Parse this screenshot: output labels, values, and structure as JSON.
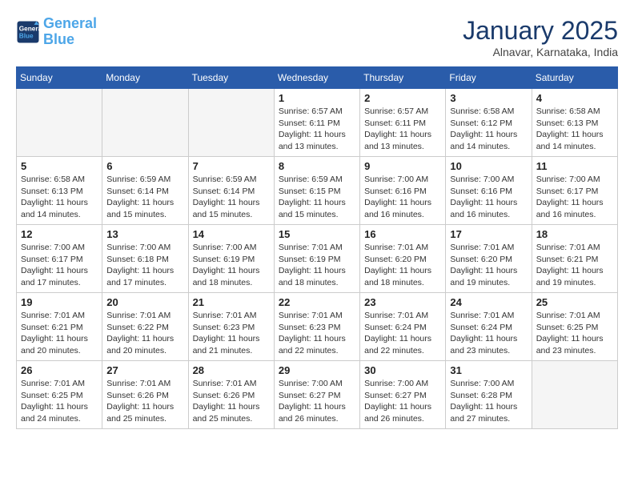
{
  "logo": {
    "line1": "General",
    "line2": "Blue"
  },
  "title": "January 2025",
  "location": "Alnavar, Karnataka, India",
  "days_of_week": [
    "Sunday",
    "Monday",
    "Tuesday",
    "Wednesday",
    "Thursday",
    "Friday",
    "Saturday"
  ],
  "weeks": [
    [
      {
        "day": "",
        "info": ""
      },
      {
        "day": "",
        "info": ""
      },
      {
        "day": "",
        "info": ""
      },
      {
        "day": "1",
        "info": "Sunrise: 6:57 AM\nSunset: 6:11 PM\nDaylight: 11 hours\nand 13 minutes."
      },
      {
        "day": "2",
        "info": "Sunrise: 6:57 AM\nSunset: 6:11 PM\nDaylight: 11 hours\nand 13 minutes."
      },
      {
        "day": "3",
        "info": "Sunrise: 6:58 AM\nSunset: 6:12 PM\nDaylight: 11 hours\nand 14 minutes."
      },
      {
        "day": "4",
        "info": "Sunrise: 6:58 AM\nSunset: 6:13 PM\nDaylight: 11 hours\nand 14 minutes."
      }
    ],
    [
      {
        "day": "5",
        "info": "Sunrise: 6:58 AM\nSunset: 6:13 PM\nDaylight: 11 hours\nand 14 minutes."
      },
      {
        "day": "6",
        "info": "Sunrise: 6:59 AM\nSunset: 6:14 PM\nDaylight: 11 hours\nand 15 minutes."
      },
      {
        "day": "7",
        "info": "Sunrise: 6:59 AM\nSunset: 6:14 PM\nDaylight: 11 hours\nand 15 minutes."
      },
      {
        "day": "8",
        "info": "Sunrise: 6:59 AM\nSunset: 6:15 PM\nDaylight: 11 hours\nand 15 minutes."
      },
      {
        "day": "9",
        "info": "Sunrise: 7:00 AM\nSunset: 6:16 PM\nDaylight: 11 hours\nand 16 minutes."
      },
      {
        "day": "10",
        "info": "Sunrise: 7:00 AM\nSunset: 6:16 PM\nDaylight: 11 hours\nand 16 minutes."
      },
      {
        "day": "11",
        "info": "Sunrise: 7:00 AM\nSunset: 6:17 PM\nDaylight: 11 hours\nand 16 minutes."
      }
    ],
    [
      {
        "day": "12",
        "info": "Sunrise: 7:00 AM\nSunset: 6:17 PM\nDaylight: 11 hours\nand 17 minutes."
      },
      {
        "day": "13",
        "info": "Sunrise: 7:00 AM\nSunset: 6:18 PM\nDaylight: 11 hours\nand 17 minutes."
      },
      {
        "day": "14",
        "info": "Sunrise: 7:00 AM\nSunset: 6:19 PM\nDaylight: 11 hours\nand 18 minutes."
      },
      {
        "day": "15",
        "info": "Sunrise: 7:01 AM\nSunset: 6:19 PM\nDaylight: 11 hours\nand 18 minutes."
      },
      {
        "day": "16",
        "info": "Sunrise: 7:01 AM\nSunset: 6:20 PM\nDaylight: 11 hours\nand 18 minutes."
      },
      {
        "day": "17",
        "info": "Sunrise: 7:01 AM\nSunset: 6:20 PM\nDaylight: 11 hours\nand 19 minutes."
      },
      {
        "day": "18",
        "info": "Sunrise: 7:01 AM\nSunset: 6:21 PM\nDaylight: 11 hours\nand 19 minutes."
      }
    ],
    [
      {
        "day": "19",
        "info": "Sunrise: 7:01 AM\nSunset: 6:21 PM\nDaylight: 11 hours\nand 20 minutes."
      },
      {
        "day": "20",
        "info": "Sunrise: 7:01 AM\nSunset: 6:22 PM\nDaylight: 11 hours\nand 20 minutes."
      },
      {
        "day": "21",
        "info": "Sunrise: 7:01 AM\nSunset: 6:23 PM\nDaylight: 11 hours\nand 21 minutes."
      },
      {
        "day": "22",
        "info": "Sunrise: 7:01 AM\nSunset: 6:23 PM\nDaylight: 11 hours\nand 22 minutes."
      },
      {
        "day": "23",
        "info": "Sunrise: 7:01 AM\nSunset: 6:24 PM\nDaylight: 11 hours\nand 22 minutes."
      },
      {
        "day": "24",
        "info": "Sunrise: 7:01 AM\nSunset: 6:24 PM\nDaylight: 11 hours\nand 23 minutes."
      },
      {
        "day": "25",
        "info": "Sunrise: 7:01 AM\nSunset: 6:25 PM\nDaylight: 11 hours\nand 23 minutes."
      }
    ],
    [
      {
        "day": "26",
        "info": "Sunrise: 7:01 AM\nSunset: 6:25 PM\nDaylight: 11 hours\nand 24 minutes."
      },
      {
        "day": "27",
        "info": "Sunrise: 7:01 AM\nSunset: 6:26 PM\nDaylight: 11 hours\nand 25 minutes."
      },
      {
        "day": "28",
        "info": "Sunrise: 7:01 AM\nSunset: 6:26 PM\nDaylight: 11 hours\nand 25 minutes."
      },
      {
        "day": "29",
        "info": "Sunrise: 7:00 AM\nSunset: 6:27 PM\nDaylight: 11 hours\nand 26 minutes."
      },
      {
        "day": "30",
        "info": "Sunrise: 7:00 AM\nSunset: 6:27 PM\nDaylight: 11 hours\nand 26 minutes."
      },
      {
        "day": "31",
        "info": "Sunrise: 7:00 AM\nSunset: 6:28 PM\nDaylight: 11 hours\nand 27 minutes."
      },
      {
        "day": "",
        "info": ""
      }
    ]
  ]
}
